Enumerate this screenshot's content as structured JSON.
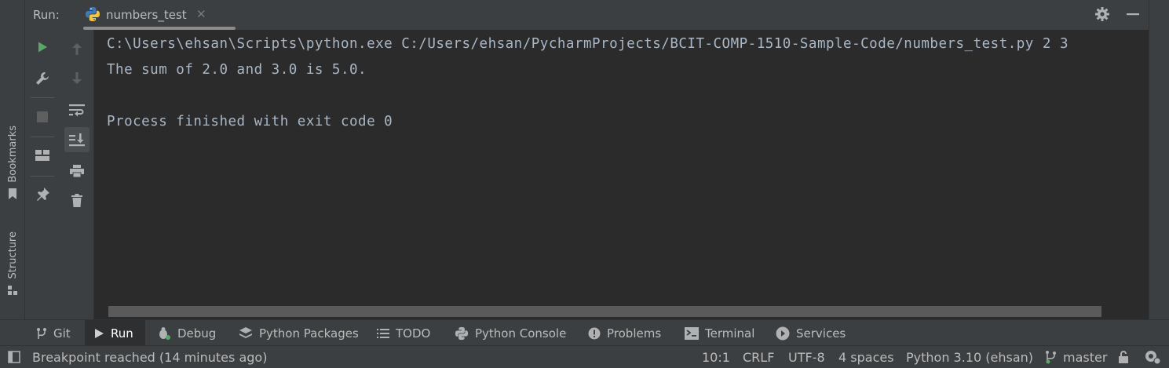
{
  "left_strip": {
    "bookmarks_label": "Bookmarks",
    "structure_label": "Structure"
  },
  "run_window": {
    "run_label": "Run:",
    "tab_title": "numbers_test",
    "tab_close": "✕"
  },
  "console": {
    "lines": [
      "C:\\Users\\ehsan\\Scripts\\python.exe C:/Users/ehsan/PycharmProjects/BCIT-COMP-1510-Sample-Code/numbers_test.py 2 3",
      "The sum of 2.0 and 3.0 is 5.0.",
      "",
      "Process finished with exit code 0"
    ]
  },
  "tool_windows": {
    "git": "Git",
    "run": "Run",
    "debug": "Debug",
    "python_packages": "Python Packages",
    "todo": "TODO",
    "python_console": "Python Console",
    "problems": "Problems",
    "terminal": "Terminal",
    "services": "Services"
  },
  "status_bar": {
    "message": "Breakpoint reached (14 minutes ago)",
    "position": "10:1",
    "line_separator": "CRLF",
    "encoding": "UTF-8",
    "indent": "4 spaces",
    "interpreter": "Python 3.10 (ehsan)",
    "branch": "master"
  },
  "colors": {
    "background": "#3c3f41",
    "console_bg": "#2b2b2b",
    "console_text": "#a9b7c6",
    "run_green": "#59a869",
    "python_blue": "#3d7ab8",
    "python_yellow": "#f4c542"
  }
}
